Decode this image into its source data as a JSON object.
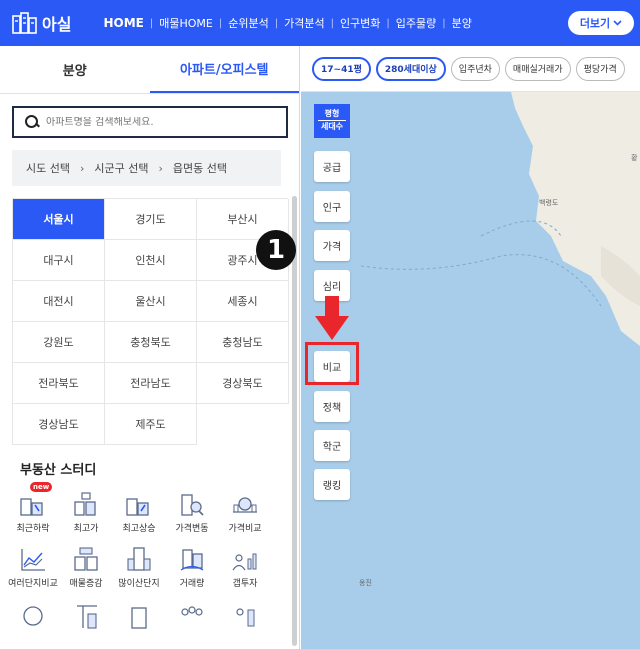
{
  "header": {
    "logo_text": "아실",
    "nav": [
      "HOME",
      "매물HOME",
      "순위분석",
      "가격분석",
      "인구변화",
      "입주물량",
      "분양"
    ],
    "more_label": "더보기"
  },
  "left_panel": {
    "tabs": [
      "분양",
      "아파트/오피스텔"
    ],
    "search_placeholder": "아파트명을 검색해보세요.",
    "region_path": [
      "시도 선택",
      "시군구 선택",
      "읍면동 선택"
    ],
    "regions": [
      "서울시",
      "경기도",
      "부산시",
      "대구시",
      "인천시",
      "광주시",
      "대전시",
      "울산시",
      "세종시",
      "강원도",
      "충청북도",
      "충청남도",
      "전라북도",
      "전라남도",
      "경상북도",
      "경상남도",
      "제주도"
    ],
    "selected_region": "서울시",
    "study_title": "부동산 스터디",
    "study_items": [
      "최근하락",
      "최고가",
      "최고상승",
      "가격변동",
      "가격비교",
      "여러단지비교",
      "매물증감",
      "많이산단지",
      "거래량",
      "갭투자",
      "",
      "",
      "",
      "",
      ""
    ],
    "new_badge": "new"
  },
  "annotation": {
    "step": "1"
  },
  "map": {
    "filters": [
      "17~41평",
      "280세대이상",
      "입주년차",
      "매매실거래가",
      "평당가격"
    ],
    "active_filters": [
      "17~41평",
      "280세대이상"
    ],
    "tool_header": [
      "평형",
      "세대수"
    ],
    "tools": [
      "공급",
      "인구",
      "가격",
      "심리",
      "비교",
      "정책",
      "학군",
      "랭킹"
    ],
    "highlighted_tool": "비교",
    "labels": [
      "백령도",
      "황",
      "옹진"
    ]
  },
  "colors": {
    "brand": "#2b59f5",
    "highlight": "#e8262b",
    "sea": "#a8cdea",
    "land": "#efece4"
  }
}
